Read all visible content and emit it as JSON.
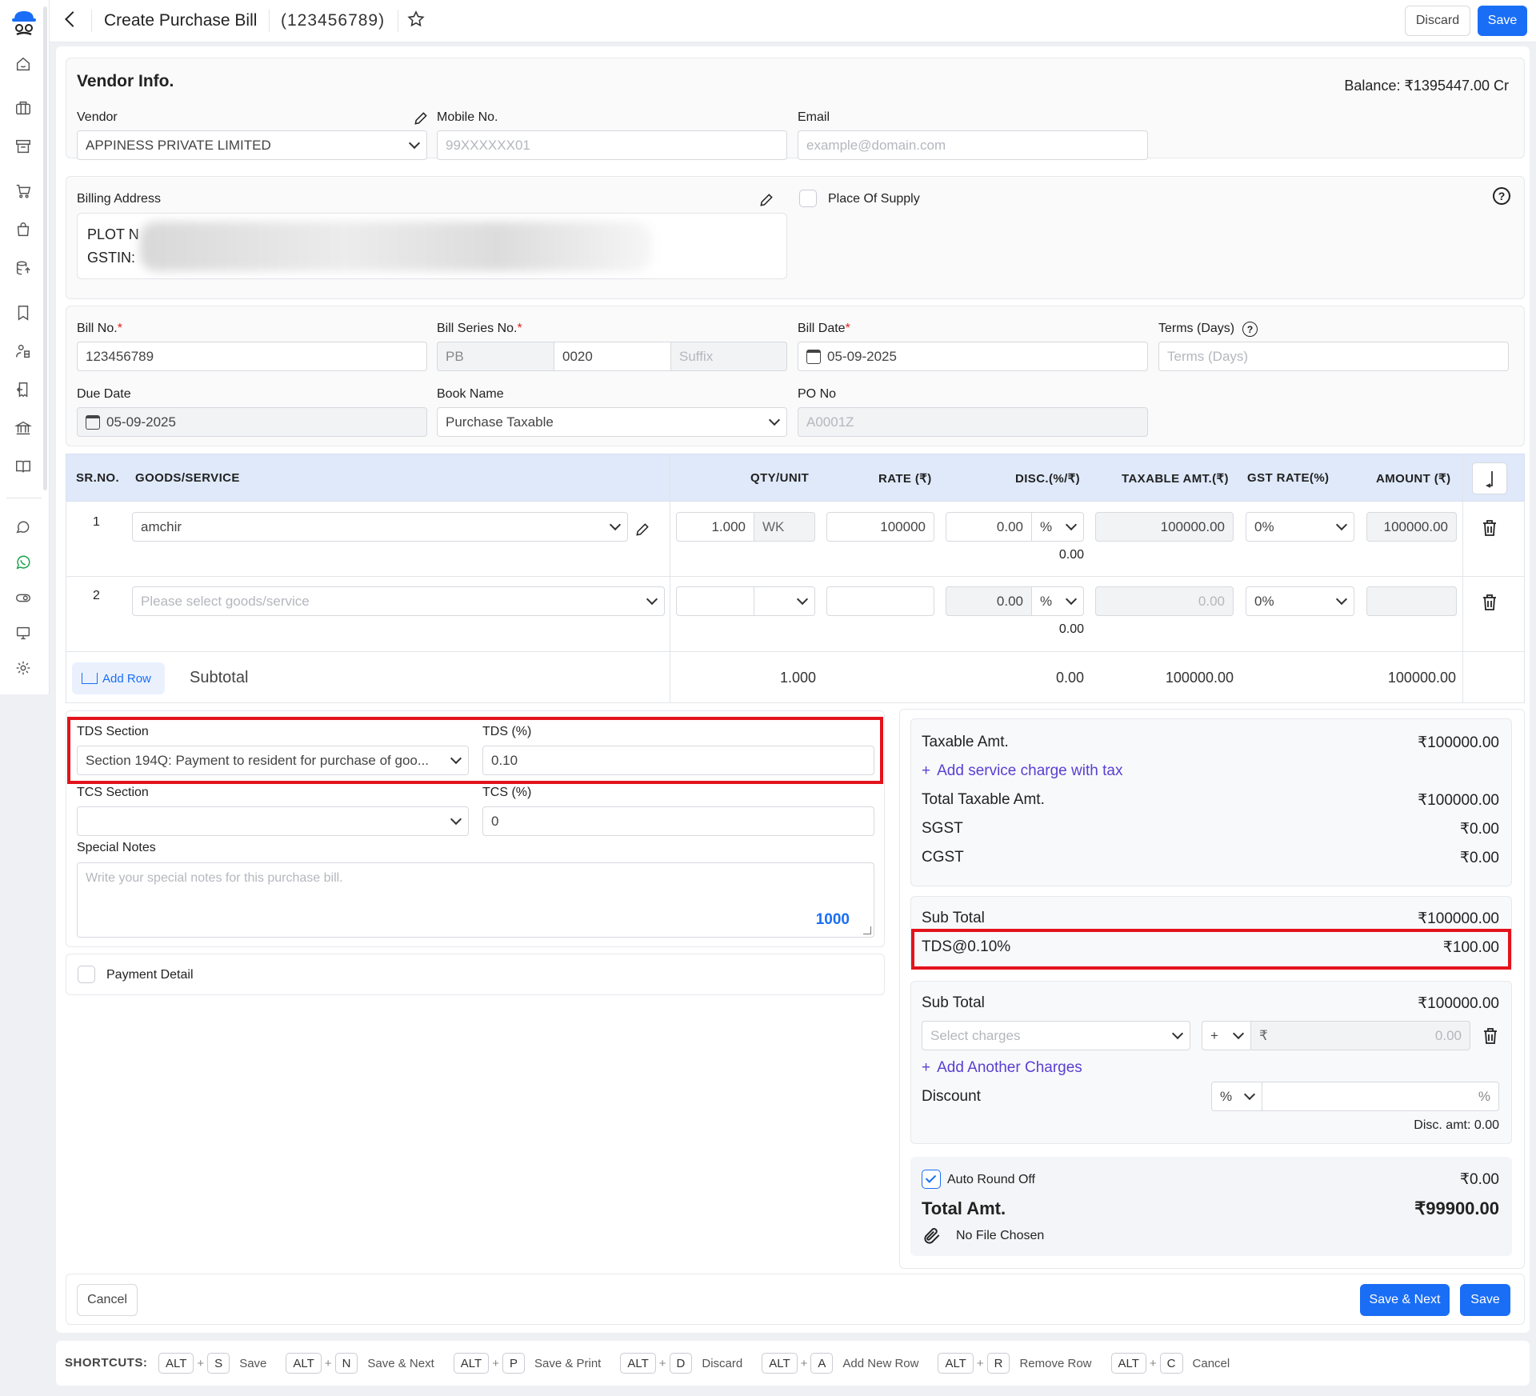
{
  "header": {
    "title": "Create Purchase Bill",
    "bill_ref": "(123456789)",
    "discard": "Discard",
    "save": "Save"
  },
  "vendor": {
    "section_title": "Vendor Info.",
    "balance": "Balance: ₹1395447.00 Cr",
    "vendor_label": "Vendor",
    "vendor_value": "APPINESS PRIVATE LIMITED",
    "mobile_label": "Mobile No.",
    "mobile_placeholder": "99XXXXXX01",
    "email_label": "Email",
    "email_placeholder": "example@domain.com"
  },
  "billing": {
    "label": "Billing Address",
    "line1": "PLOT N",
    "line2": "GSTIN:",
    "place_of_supply": "Place Of Supply"
  },
  "bill": {
    "bill_no_label": "Bill No.",
    "bill_no": "123456789",
    "series_label": "Bill Series No.",
    "series_prefix": "PB",
    "series_num": "0020",
    "series_suffix": "Suffix",
    "date_label": "Bill Date",
    "date": "05-09-2025",
    "terms_label": "Terms (Days)",
    "terms_placeholder": "Terms (Days)",
    "due_label": "Due Date",
    "due": "05-09-2025",
    "book_label": "Book Name",
    "book": "Purchase Taxable",
    "po_label": "PO No",
    "po": "A0001Z",
    "req": "*"
  },
  "table": {
    "headers": [
      "SR.NO.",
      "GOODS/SERVICE",
      "QTY/UNIT",
      "RATE (₹)",
      "DISC.(%/₹)",
      "TAXABLE AMT.(₹)",
      "GST RATE(%)",
      "AMOUNT (₹)"
    ],
    "rows": [
      {
        "sr": "1",
        "item": "amchir",
        "qty": "1.000",
        "unit": "WK",
        "rate": "100000",
        "disc": "0.00",
        "disc_type": "%",
        "disc_amt": "0.00",
        "taxable": "100000.00",
        "gst": "0%",
        "amount": "100000.00"
      },
      {
        "sr": "2",
        "item": "Please select goods/service",
        "qty": "",
        "unit": "",
        "rate": "",
        "disc": "0.00",
        "disc_type": "%",
        "disc_amt": "0.00",
        "taxable": "0.00",
        "gst": "0%",
        "amount": ""
      }
    ],
    "add_row": "Add Row",
    "subtotal_label": "Subtotal",
    "sub_qty": "1.000",
    "sub_disc": "0.00",
    "sub_taxable": "100000.00",
    "sub_amount": "100000.00"
  },
  "tds": {
    "section_label": "TDS Section",
    "section_value": "Section 194Q: Payment to resident for purchase of goo...",
    "pct_label": "TDS (%)",
    "pct_value": "0.10"
  },
  "tcs": {
    "section_label": "TCS Section",
    "pct_label": "TCS (%)",
    "pct_value": "0"
  },
  "notes": {
    "label": "Special Notes",
    "placeholder": "Write your special notes for this purchase bill.",
    "counter": "1000"
  },
  "payment": {
    "label": "Payment Detail"
  },
  "summary": {
    "taxable_label": "Taxable Amt.",
    "taxable": "₹100000.00",
    "add_service": "Add service charge with tax",
    "total_taxable_label": "Total Taxable Amt.",
    "total_taxable": "₹100000.00",
    "sgst_label": "SGST",
    "sgst": "₹0.00",
    "cgst_label": "CGST",
    "cgst": "₹0.00",
    "subtotal_label": "Sub Total",
    "subtotal": "₹100000.00",
    "tds_label": "TDS@0.10%",
    "tds": "₹100.00",
    "subtotal2_label": "Sub Total",
    "subtotal2": "₹100000.00",
    "charges_placeholder": "Select charges",
    "charge_sign": "+",
    "currency": "₹",
    "charge_amt": "0.00",
    "add_charges": "Add Another Charges",
    "discount_label": "Discount",
    "discount_type": "%",
    "discount_suffix": "%",
    "disc_amt": "Disc. amt: 0.00",
    "round_label": "Auto Round Off",
    "round": "₹0.00",
    "total_label": "Total Amt.",
    "total": "₹99900.00",
    "file": "No File Chosen"
  },
  "footer": {
    "cancel": "Cancel",
    "save_next": "Save & Next",
    "save": "Save"
  },
  "shortcuts": {
    "label": "SHORTCUTS:",
    "items": [
      {
        "key": "S",
        "action": "Save"
      },
      {
        "key": "N",
        "action": "Save & Next"
      },
      {
        "key": "P",
        "action": "Save & Print"
      },
      {
        "key": "D",
        "action": "Discard"
      },
      {
        "key": "A",
        "action": "Add New Row"
      },
      {
        "key": "R",
        "action": "Remove Row"
      },
      {
        "key": "C",
        "action": "Cancel"
      }
    ],
    "alt": "ALT",
    "plus": "+"
  },
  "colors": {
    "primary": "#1a6ef5",
    "highlight": "#e3131b",
    "table_header": "#dfe9fa",
    "whatsapp": "#16a34a"
  }
}
